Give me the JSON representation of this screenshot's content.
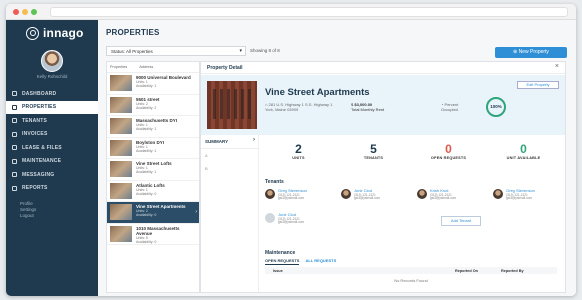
{
  "app": {
    "name": "innago"
  },
  "user": {
    "name": "Kelly Rohschild"
  },
  "nav": [
    {
      "label": "DASHBOARD",
      "icon": "dashboard-icon",
      "active": false
    },
    {
      "label": "PROPERTIES",
      "icon": "home-icon",
      "active": true
    },
    {
      "label": "TENANTS",
      "icon": "users-icon",
      "active": false
    },
    {
      "label": "INVOICES",
      "icon": "invoice-icon",
      "active": false
    },
    {
      "label": "LEASE & FILES",
      "icon": "file-icon",
      "active": false
    },
    {
      "label": "MAINTENANCE",
      "icon": "wrench-icon",
      "active": false
    },
    {
      "label": "MESSAGING",
      "icon": "message-icon",
      "active": false
    },
    {
      "label": "REPORTS",
      "icon": "chart-icon",
      "active": false
    }
  ],
  "sub_links": [
    "Profile",
    "Settings",
    "Logout"
  ],
  "page": {
    "title": "PROPERTIES"
  },
  "toolbar": {
    "filter_label": "Status: All Properties",
    "showing": "Showing 8 of 8",
    "new_property": "New Property"
  },
  "plist": {
    "col_properties": "Properties",
    "col_address": "Address",
    "items": [
      {
        "name": "9000 Universal Boulevard",
        "units": "Units: 1",
        "availability": "Availability: 1"
      },
      {
        "name": "5501 street",
        "units": "Units: 2",
        "availability": "Availability: 2"
      },
      {
        "name": "Massachusetts DYI",
        "units": "Units: 1",
        "availability": "Availability: 1"
      },
      {
        "name": "Boylston DYI",
        "units": "Units: 1",
        "availability": "Availability: 1"
      },
      {
        "name": "Vine Street Lofts",
        "units": "Units: 1",
        "availability": "Availability: 1"
      },
      {
        "name": "Atlantic Lofts",
        "units": "Units: 1",
        "availability": "Availability: 0"
      },
      {
        "name": "Vine Street Apartments",
        "units": "Units: 2",
        "availability": "Availability: 0"
      },
      {
        "name": "1010 Massachusetts Avenue",
        "units": "Units: 5",
        "availability": "Availability: 0"
      }
    ]
  },
  "detail": {
    "header": "Property Detail",
    "title": "Vine Street Apartments",
    "address_line1": "281 U.S. Highway 1 S.S. Highway 1",
    "address_line2": "York, Maine 03909",
    "rent_value": "$3,000.00",
    "rent_label": "Total Monthly Rent",
    "occupied_label1": "Percent",
    "occupied_label2": "Occupied",
    "occupied_pct": "100%",
    "edit_label": "Edit Property",
    "tab_summary": "SUMMARY",
    "tab_a": "A",
    "tab_b": "B"
  },
  "stats": [
    {
      "num": "2",
      "label": "UNITS",
      "color": "default"
    },
    {
      "num": "5",
      "label": "TENANTS",
      "color": "default"
    },
    {
      "num": "0",
      "label": "OPEN REQUESTS",
      "color": "red"
    },
    {
      "num": "0",
      "label": "UNIT AVAILABLE",
      "color": "green"
    }
  ],
  "tenants": {
    "title": "Tenants",
    "add_label": "Add Tenant",
    "list": [
      {
        "name": "Greg Stevenson",
        "phone": "(313) 121-2121",
        "email": "gst3@ystmail.com"
      },
      {
        "name": "Junir Clod",
        "phone": "(313) 121-2121",
        "email": "gst3@ystmail.com"
      },
      {
        "name": "Krish Knot",
        "phone": "(313) 121-2121",
        "email": "gst3@ystmail.com"
      },
      {
        "name": "Greg Stevenson",
        "phone": "(313) 121-2121",
        "email": "gst3@ystmail.com"
      },
      {
        "name": "Junir Clod",
        "phone": "(313) 121-2121",
        "email": "gst3@ystmail.com"
      }
    ]
  },
  "maintenance": {
    "title": "Maintenance",
    "tab_open": "OPEN REQUESTS",
    "tab_all": "ALL REQUESTS",
    "col_issue": "Issue",
    "col_reported_on": "Reported On",
    "col_reported_by": "Reported By",
    "empty": "No Records Found"
  },
  "colors": {
    "sidebar": "#1f3a4f",
    "accent": "#2e8fd6",
    "red": "#e2574c",
    "green": "#2fa57a"
  }
}
